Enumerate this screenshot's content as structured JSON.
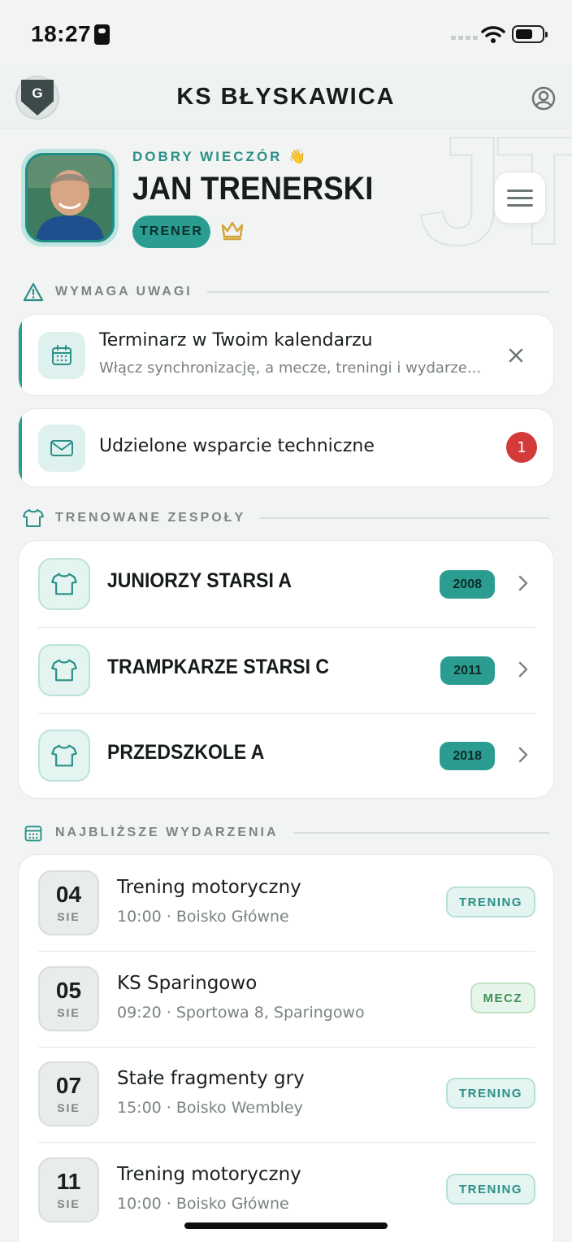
{
  "status_bar": {
    "time": "18:27"
  },
  "header": {
    "title": "KS BŁYSKAWICA",
    "logo_letter": "G"
  },
  "hero": {
    "greeting": "DOBRY WIECZÓR 👋",
    "name": "JAN TRENERSKI",
    "role": "TRENER",
    "watermark": "JT"
  },
  "sections": {
    "attention": "WYMAGA UWAGI",
    "teams": "TRENOWANE ZESPOŁY",
    "events": "NAJBLIŻSZE WYDARZENIA"
  },
  "alerts": [
    {
      "title": "Terminarz w Twoim kalendarzu",
      "text": "Włącz synchronizację, a mecze, treningi i wydarze..."
    },
    {
      "title": "Udzielone wsparcie techniczne",
      "count": "1"
    }
  ],
  "teams": [
    {
      "name": "JUNIORZY STARSI A",
      "year": "2008"
    },
    {
      "name": "TRAMPKARZE STARSI C",
      "year": "2011"
    },
    {
      "name": "PRZEDSZKOLE A",
      "year": "2018"
    }
  ],
  "events": [
    {
      "day": "04",
      "month": "SIE",
      "title": "Trening motoryczny",
      "details": "10:00 · Boisko Główne",
      "type": "TRENING"
    },
    {
      "day": "05",
      "month": "SIE",
      "title": "KS Sparingowo",
      "details": "09:20 · Sportowa 8, Sparingowo",
      "type": "MECZ"
    },
    {
      "day": "07",
      "month": "SIE",
      "title": "Stałe fragmenty gry",
      "details": "15:00 · Boisko Wembley",
      "type": "TRENING"
    },
    {
      "day": "11",
      "month": "SIE",
      "title": "Trening motoryczny",
      "details": "10:00 · Boisko Główne",
      "type": "TRENING"
    }
  ],
  "colors": {
    "accent": "#2a9d90",
    "danger": "#d33a3a",
    "match": "#3f8f55"
  }
}
